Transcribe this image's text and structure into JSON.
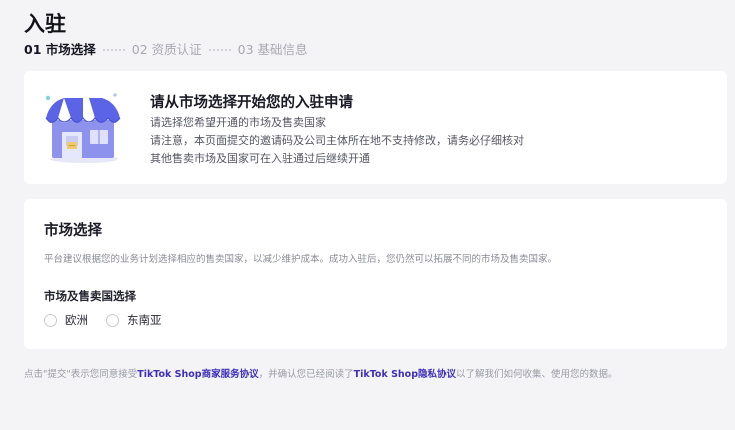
{
  "page": {
    "title": "入驻"
  },
  "steps": [
    {
      "label": "01 市场选择",
      "state": "active"
    },
    {
      "label": "02 资质认证",
      "state": "inactive"
    },
    {
      "label": "03 基础信息",
      "state": "inactive"
    }
  ],
  "intro": {
    "title": "请从市场选择开始您的入驻申请",
    "line1": "请选择您希望开通的市场及售卖国家",
    "line2": "请注意，本页面提交的邀请码及公司主体所在地不支持修改，请务必仔细核对",
    "line3": "其他售卖市场及国家可在入驻通过后继续开通",
    "illustration_icon": "storefront-icon"
  },
  "market": {
    "title": "市场选择",
    "description": "平台建议根据您的业务计划选择相应的售卖国家，以减少维护成本。成功入驻后，您仍然可以拓展不同的市场及售卖国家。",
    "region_label": "市场及售卖国选择",
    "options": [
      {
        "label": "欧洲",
        "selected": false
      },
      {
        "label": "东南亚",
        "selected": false
      }
    ]
  },
  "footer": {
    "text_before": "点击\"提交\"表示您同意接受",
    "brand1": "TikTok Shop",
    "link1": "商家服务协议",
    "text_middle": "，并确认您已经阅读了",
    "brand2": "TikTok Shop",
    "link2": "隐私协议",
    "text_after": "以了解我们如何收集、使用您的数据。"
  },
  "colors": {
    "accent": "#3d2fb8",
    "background": "#f4f4f7",
    "card": "#ffffff",
    "illustration_blue": "#5b63e6"
  }
}
